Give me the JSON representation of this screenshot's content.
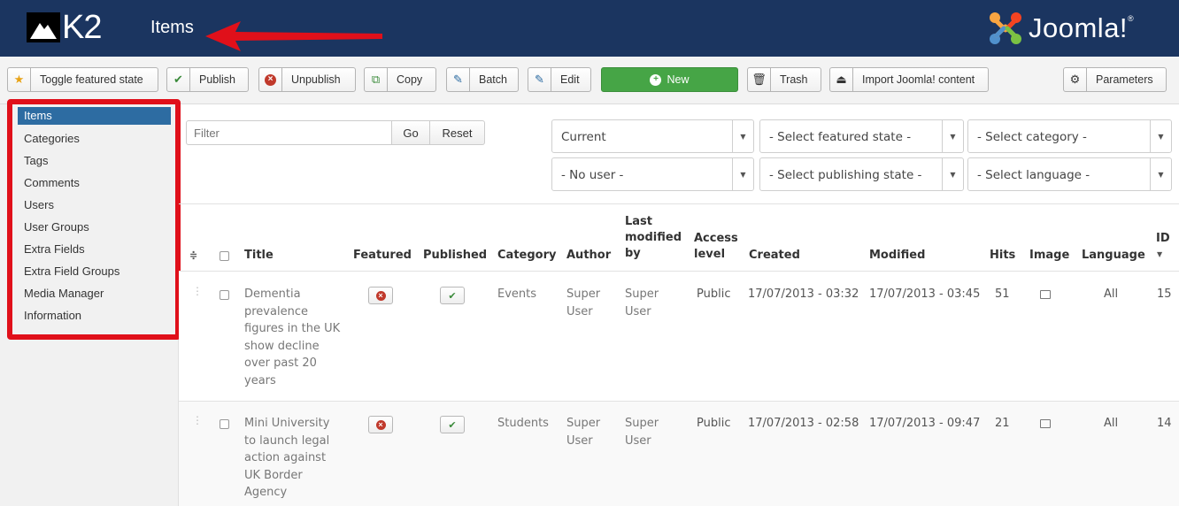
{
  "header": {
    "k2_logo_text": "K2",
    "title": "Items",
    "joomla_logo_text": "Joomla!",
    "joomla_trademark": "®"
  },
  "toolbar": {
    "toggle_featured": "Toggle featured state",
    "publish": "Publish",
    "unpublish": "Unpublish",
    "copy": "Copy",
    "batch": "Batch",
    "edit": "Edit",
    "new": "New",
    "trash": "Trash",
    "import": "Import Joomla! content",
    "parameters": "Parameters"
  },
  "sidebar": {
    "items": [
      {
        "label": "Items",
        "active": true
      },
      {
        "label": "Categories"
      },
      {
        "label": "Tags"
      },
      {
        "label": "Comments"
      },
      {
        "label": "Users"
      },
      {
        "label": "User Groups"
      },
      {
        "label": "Extra Fields"
      },
      {
        "label": "Extra Field Groups"
      },
      {
        "label": "Media Manager"
      },
      {
        "label": "Information"
      }
    ]
  },
  "filters": {
    "search_placeholder": "Filter",
    "go": "Go",
    "reset": "Reset",
    "trash_state": "Current",
    "featured_state": "- Select featured state -",
    "category": "- Select category -",
    "user": "- No user -",
    "publishing_state": "- Select publishing state -",
    "language": "- Select language -"
  },
  "table": {
    "headers": {
      "order": "≑",
      "title": "Title",
      "featured": "Featured",
      "published": "Published",
      "category": "Category",
      "author": "Author",
      "last_modified_by_1": "Last",
      "last_modified_by_2": "modified",
      "last_modified_by_3": "by",
      "access_level_1": "Access",
      "access_level_2": "level",
      "created": "Created",
      "modified": "Modified",
      "hits": "Hits",
      "image": "Image",
      "language": "Language",
      "id": "ID"
    },
    "rows": [
      {
        "title_lines": [
          "Dementia",
          "prevalence",
          "figures in the UK",
          "show decline",
          "over past 20",
          "years"
        ],
        "featured": false,
        "published": true,
        "category": "Events",
        "author_lines": [
          "Super",
          "User"
        ],
        "modified_by_lines": [
          "Super",
          "User"
        ],
        "access": "Public",
        "created": "17/07/2013 - 03:32",
        "modified": "17/07/2013 - 03:45",
        "hits": "51",
        "language": "All",
        "id": "15"
      },
      {
        "title_lines": [
          "Mini University",
          "to launch legal",
          "action against",
          "UK Border",
          "Agency"
        ],
        "featured": false,
        "published": true,
        "category": "Students",
        "author_lines": [
          "Super",
          "User"
        ],
        "modified_by_lines": [
          "Super",
          "User"
        ],
        "access": "Public",
        "created": "17/07/2013 - 02:58",
        "modified": "17/07/2013 - 09:47",
        "hits": "21",
        "language": "All",
        "id": "14"
      }
    ]
  },
  "colors": {
    "header_bg": "#1b3560",
    "annotation_red": "#e0101a",
    "new_button": "#46a546",
    "active_sidebar": "#2d6ca2"
  }
}
